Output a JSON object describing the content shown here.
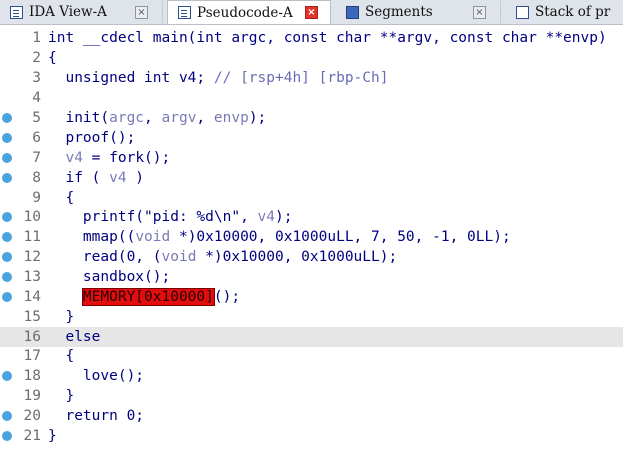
{
  "tabs": [
    {
      "label": "IDA View-A",
      "active": false,
      "icon": "ida-view-icon",
      "close": "×"
    },
    {
      "label": "Pseudocode-A",
      "active": true,
      "icon": "pseudocode-icon",
      "close": "×"
    },
    {
      "label": "Segments",
      "active": false,
      "icon": "segments-icon",
      "close": "×"
    },
    {
      "label": "Stack of pr",
      "active": false,
      "icon": "stack-icon",
      "close": ""
    }
  ],
  "colors": {
    "keyword": "#000080",
    "comment": "#6b6bb5",
    "variable": "#7a7ab8",
    "error_highlight": "#e20d0d",
    "breakpoint": "#4aa3df",
    "current_line": "#e6e6e6"
  },
  "lines": [
    {
      "num": "1",
      "bp": false,
      "hl": false,
      "tokens": [
        [
          "int __cdecl main(int argc, const char **argv, const char **envp)",
          "kw"
        ]
      ]
    },
    {
      "num": "2",
      "bp": false,
      "hl": false,
      "tokens": [
        [
          "{",
          "kw"
        ]
      ]
    },
    {
      "num": "3",
      "bp": false,
      "hl": false,
      "tokens": [
        [
          "  unsigned int v4; ",
          "kw"
        ],
        [
          "// [rsp+4h] [rbp-Ch]",
          "cm"
        ]
      ]
    },
    {
      "num": "4",
      "bp": false,
      "hl": false,
      "tokens": []
    },
    {
      "num": "5",
      "bp": true,
      "hl": false,
      "tokens": [
        [
          "  init(",
          "kw"
        ],
        [
          "argc",
          "vr"
        ],
        [
          ", ",
          "kw"
        ],
        [
          "argv",
          "vr"
        ],
        [
          ", ",
          "kw"
        ],
        [
          "envp",
          "vr"
        ],
        [
          ");",
          "kw"
        ]
      ]
    },
    {
      "num": "6",
      "bp": true,
      "hl": false,
      "tokens": [
        [
          "  proof();",
          "kw"
        ]
      ]
    },
    {
      "num": "7",
      "bp": true,
      "hl": false,
      "tokens": [
        [
          "  ",
          "kw"
        ],
        [
          "v4",
          "vr"
        ],
        [
          " = fork();",
          "kw"
        ]
      ]
    },
    {
      "num": "8",
      "bp": true,
      "hl": false,
      "tokens": [
        [
          "  if ( ",
          "kw"
        ],
        [
          "v4",
          "vr"
        ],
        [
          " )",
          "kw"
        ]
      ]
    },
    {
      "num": "9",
      "bp": false,
      "hl": false,
      "tokens": [
        [
          "  {",
          "kw"
        ]
      ]
    },
    {
      "num": "10",
      "bp": true,
      "hl": false,
      "tokens": [
        [
          "    printf(",
          "kw"
        ],
        [
          "\"pid: %d\\n\"",
          "st"
        ],
        [
          ", ",
          "kw"
        ],
        [
          "v4",
          "vr"
        ],
        [
          ");",
          "kw"
        ]
      ]
    },
    {
      "num": "11",
      "bp": true,
      "hl": false,
      "tokens": [
        [
          "    mmap((",
          "kw"
        ],
        [
          "void",
          "vr"
        ],
        [
          " *)0x10000, 0x1000uLL, 7, 50, -1, 0LL);",
          "kw"
        ]
      ]
    },
    {
      "num": "12",
      "bp": true,
      "hl": false,
      "tokens": [
        [
          "    read(0, (",
          "kw"
        ],
        [
          "void",
          "vr"
        ],
        [
          " *)0x10000, 0x1000uLL);",
          "kw"
        ]
      ]
    },
    {
      "num": "13",
      "bp": true,
      "hl": false,
      "tokens": [
        [
          "    sandbox();",
          "kw"
        ]
      ]
    },
    {
      "num": "14",
      "bp": true,
      "hl": false,
      "tokens": [
        [
          "    ",
          "kw"
        ],
        [
          "MEMORY[0x10000]",
          "er"
        ],
        [
          "();",
          "kw"
        ]
      ]
    },
    {
      "num": "15",
      "bp": false,
      "hl": false,
      "tokens": [
        [
          "  }",
          "kw"
        ]
      ]
    },
    {
      "num": "16",
      "bp": false,
      "hl": true,
      "tokens": [
        [
          "  else",
          "kw"
        ]
      ]
    },
    {
      "num": "17",
      "bp": false,
      "hl": false,
      "tokens": [
        [
          "  {",
          "kw"
        ]
      ]
    },
    {
      "num": "18",
      "bp": true,
      "hl": false,
      "tokens": [
        [
          "    love();",
          "kw"
        ]
      ]
    },
    {
      "num": "19",
      "bp": false,
      "hl": false,
      "tokens": [
        [
          "  }",
          "kw"
        ]
      ]
    },
    {
      "num": "20",
      "bp": true,
      "hl": false,
      "tokens": [
        [
          "  return 0;",
          "kw"
        ]
      ]
    },
    {
      "num": "21",
      "bp": true,
      "hl": false,
      "tokens": [
        [
          "}",
          "kw"
        ]
      ]
    }
  ]
}
